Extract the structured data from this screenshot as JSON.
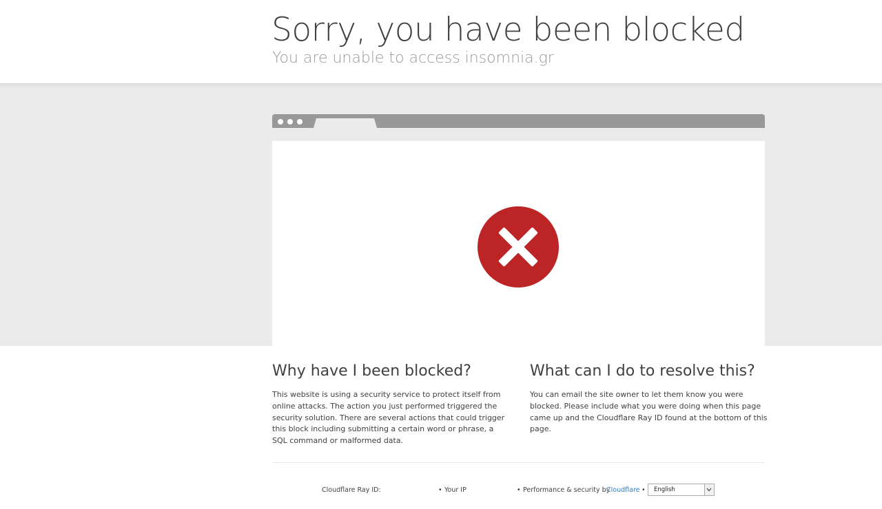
{
  "header": {
    "title": "Sorry, you have been blocked",
    "subtitle": "You are unable to access insomnia.gr"
  },
  "icons": {
    "error": "error-x-circle-icon",
    "browser_dots": "window-dots-icon",
    "select_arrow": "chevron-down-icon"
  },
  "colors": {
    "error_red": "#bd2426",
    "band_gray": "#ebebeb",
    "browser_bar": "#999999",
    "link_blue": "#2f7bbf"
  },
  "why": {
    "title": "Why have I been blocked?",
    "text": "This website is using a security service to protect itself from online attacks. The action you just performed triggered the security solution. There are several actions that could trigger this block including submitting a certain word or phrase, a SQL command or malformed data."
  },
  "resolve": {
    "title": "What can I do to resolve this?",
    "text": "You can email the site owner to let them know you were blocked. Please include what you were doing when this page came up and the Cloudflare Ray ID found at the bottom of this page."
  },
  "footer": {
    "ray_id_label": "Cloudflare Ray ID:",
    "ray_id_value": "",
    "separator": "•",
    "your_ip_label": "Your IP",
    "performance_label": "Performance & security by",
    "cloudflare_link": "Cloudflare",
    "language_selected": "English"
  }
}
